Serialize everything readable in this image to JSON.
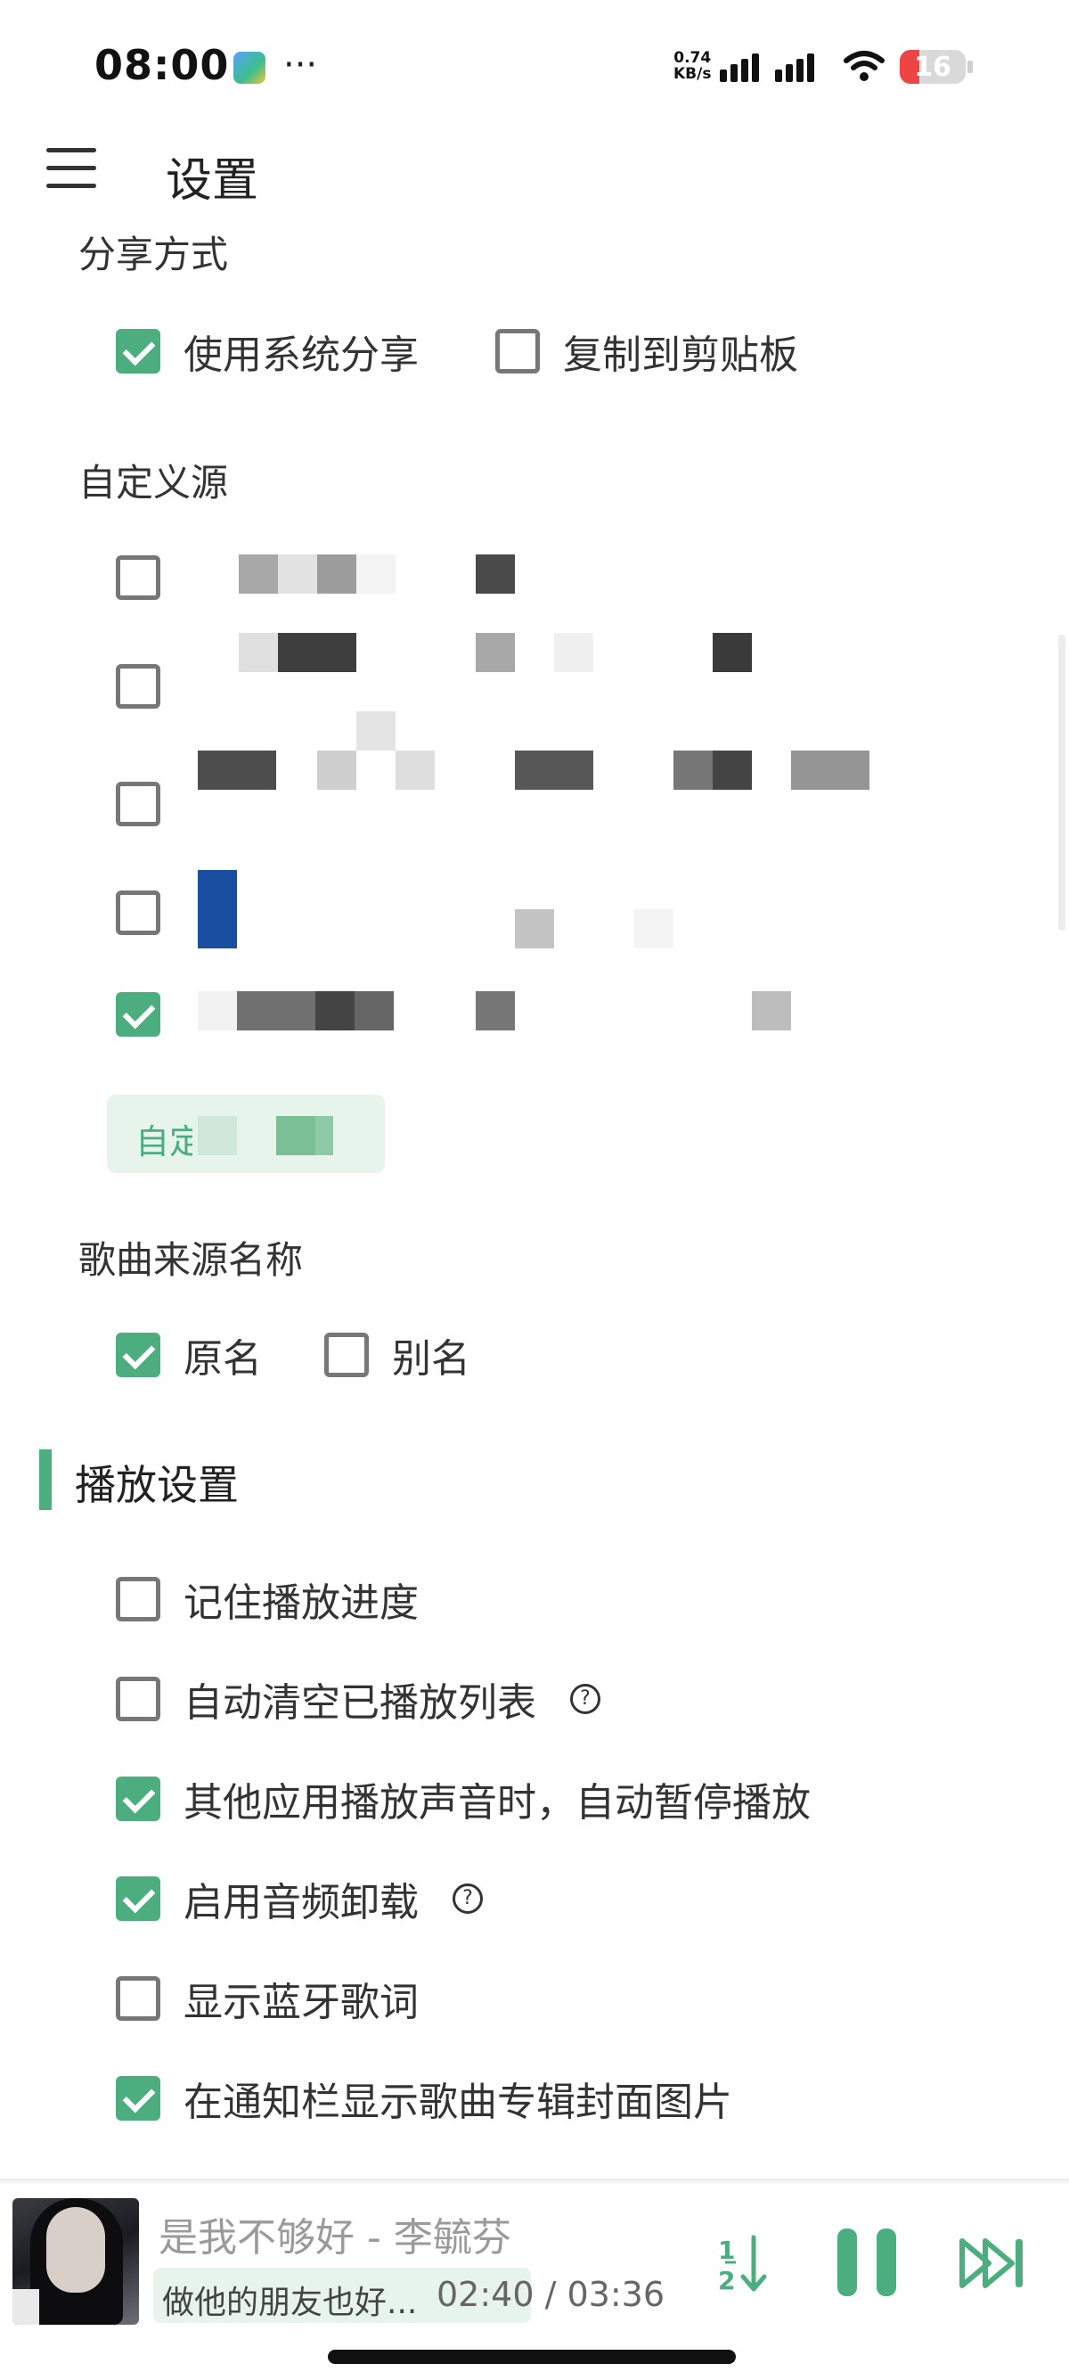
{
  "status_bar": {
    "time": "08:00",
    "net_speed_value": "0.74",
    "net_speed_unit": "KB/s",
    "battery": "16",
    "icons": [
      "gallery-icon",
      "more-dots-icon",
      "signal-icon",
      "wifi-icon",
      "battery-icon"
    ]
  },
  "header": {
    "title": "设置",
    "menu_icon": "hamburger-menu-icon"
  },
  "share_method": {
    "label": "分享方式",
    "options": [
      {
        "label": "使用系统分享",
        "checked": true
      },
      {
        "label": "复制到剪贴板",
        "checked": false
      }
    ]
  },
  "custom_source": {
    "label": "自定义源",
    "sources_checked": [
      false,
      false,
      false,
      false,
      true
    ],
    "button_label": "自定义源管理"
  },
  "song_source_name": {
    "label": "歌曲来源名称",
    "options": [
      {
        "label": "原名",
        "checked": true
      },
      {
        "label": "别名",
        "checked": false
      }
    ]
  },
  "playback": {
    "heading": "播放设置",
    "accent_color": "#4cae7e",
    "options": [
      {
        "label": "记住播放进度",
        "checked": false,
        "help": false
      },
      {
        "label": "自动清空已播放列表",
        "checked": false,
        "help": true
      },
      {
        "label": "其他应用播放声音时，自动暂停播放",
        "checked": true,
        "help": false
      },
      {
        "label": "启用音频卸载",
        "checked": true,
        "help": true
      },
      {
        "label": "显示蓝牙歌词",
        "checked": false,
        "help": false
      },
      {
        "label": "在通知栏显示歌曲专辑封面图片",
        "checked": true,
        "help": false
      }
    ],
    "help_glyph": "?"
  },
  "player": {
    "song": "是我不够好 - 李毓芬",
    "lyric": "做他的朋友也好...",
    "current_time": "02:40",
    "separator": " / ",
    "total_time": "03:36",
    "order_icon_label": "12",
    "icons": [
      "album-cover",
      "play-order-icon",
      "pause-icon",
      "next-track-icon"
    ]
  }
}
